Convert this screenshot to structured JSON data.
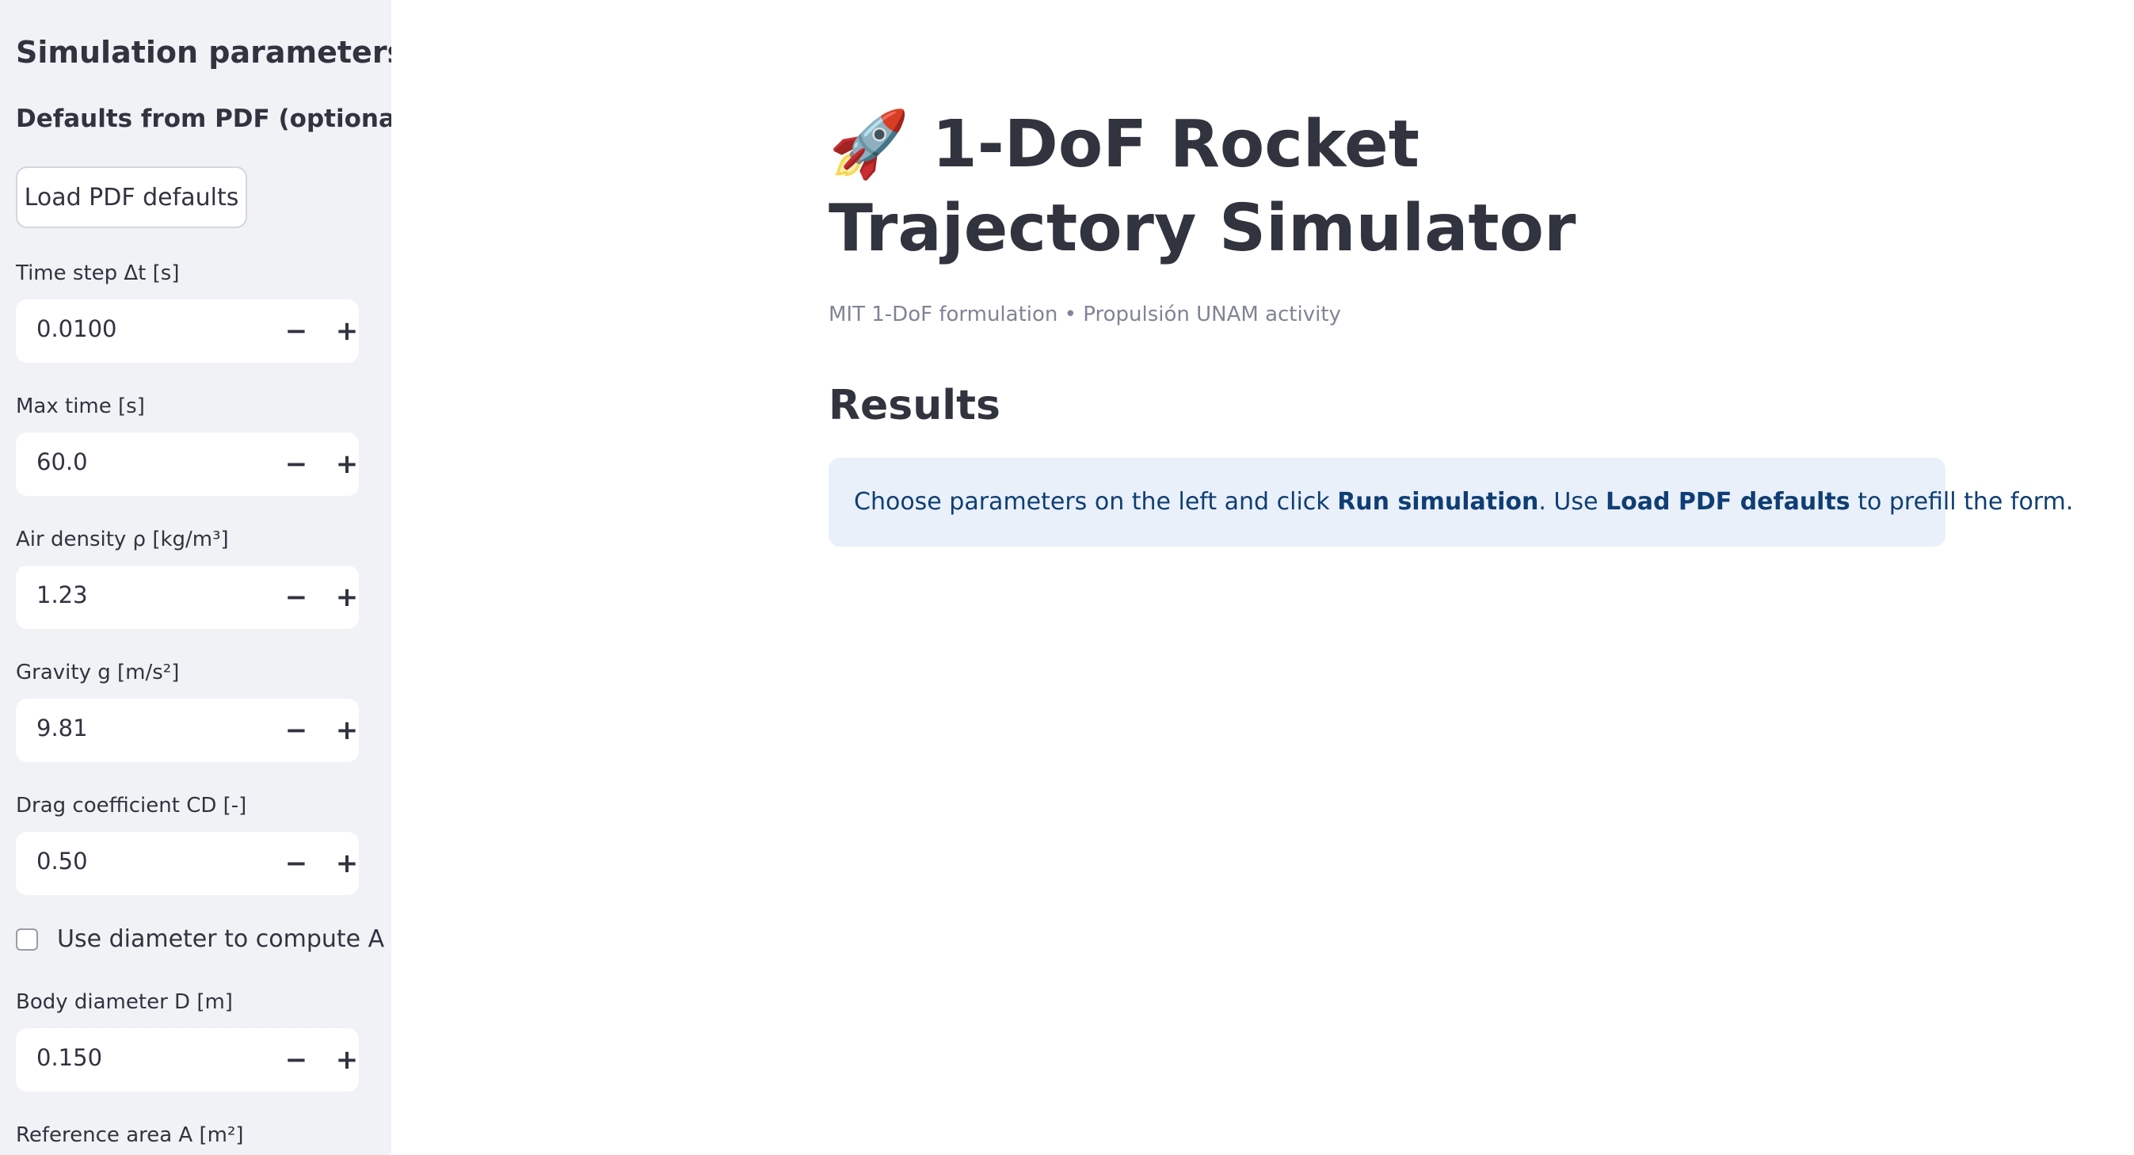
{
  "sidebar": {
    "title": "Simulation parameters",
    "defaults_header": "Defaults from PDF (optional)",
    "load_pdf_button": "Load PDF defaults",
    "fields": [
      {
        "label": "Time step Δt [s]",
        "value": "0.0100"
      },
      {
        "label": "Max time [s]",
        "value": "60.0"
      },
      {
        "label": "Air density ρ [kg/m³]",
        "value": "1.23"
      },
      {
        "label": "Gravity g [m/s²]",
        "value": "9.81"
      },
      {
        "label": "Drag coefficient CD [-]",
        "value": "0.50"
      }
    ],
    "use_diameter_checkbox": {
      "label": "Use diameter to compute A",
      "checked": false
    },
    "body_diameter": {
      "label": "Body diameter D [m]",
      "value": "0.150"
    },
    "reference_area": {
      "label": "Reference area A [m²]"
    },
    "stepper_minus": "−",
    "stepper_plus": "+"
  },
  "main": {
    "title_icon": "🚀",
    "title": "1-DoF Rocket Trajectory Simulator",
    "caption": "MIT 1-DoF formulation • Propulsión UNAM activity",
    "results_heading": "Results",
    "info": {
      "part1": "Choose parameters on the left and click ",
      "bold1": "Run simulation",
      "part2": ". Use ",
      "bold2": "Load PDF defaults",
      "part3": " to prefill the form."
    }
  },
  "colors": {
    "sidebar_bg": "#f0f2f6",
    "info_bg": "#e9f0fa",
    "info_text": "#0f3e74",
    "caption_text": "#808495"
  }
}
